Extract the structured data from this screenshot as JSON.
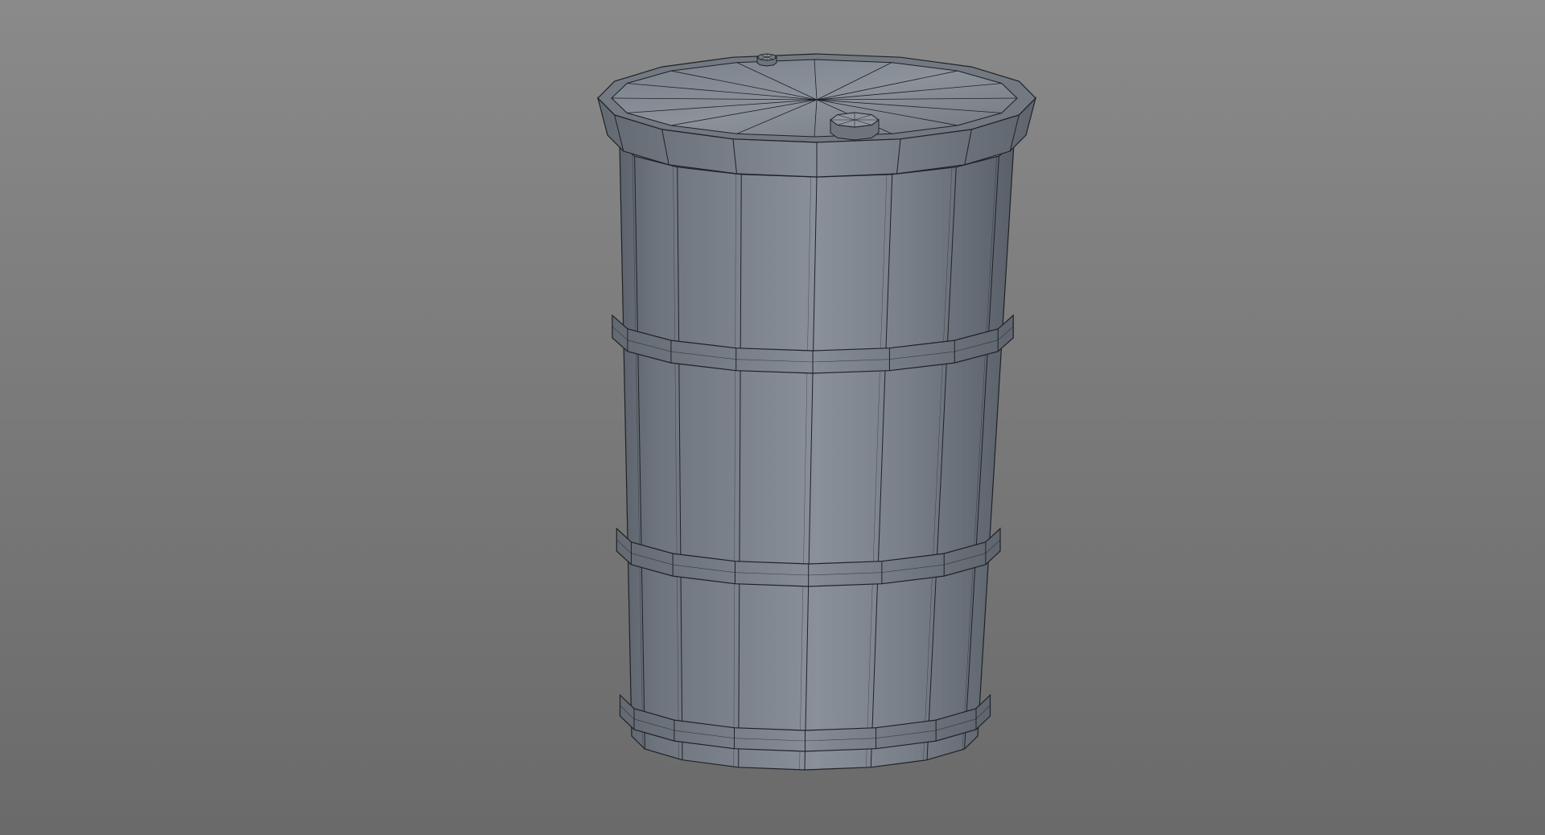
{
  "scene": {
    "background_top": "#8a8a8a",
    "background_bottom": "#6a6a6a",
    "object": "barrel",
    "render_mode": "shaded-wireframe",
    "shade_light": "#9aa0a8",
    "shade_mid": "#7d838c",
    "shade_dark": "#5a6069",
    "wire_color": "#1e2226",
    "segment_count": 16,
    "hoop_count": 4
  }
}
